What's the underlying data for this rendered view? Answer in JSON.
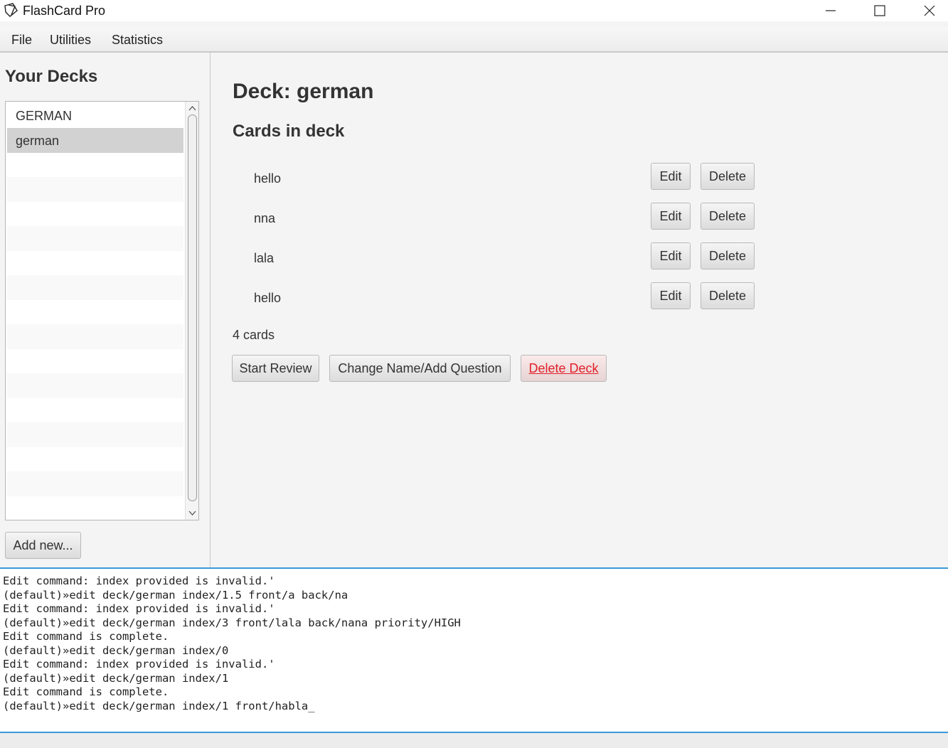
{
  "window": {
    "title": "FlashCard Pro"
  },
  "menu": {
    "items": [
      "File",
      "Utilities",
      "Statistics"
    ]
  },
  "sidebar": {
    "title": "Your Decks",
    "decks": [
      "GERMAN",
      "german"
    ],
    "selected_index": 1,
    "add_button": "Add new..."
  },
  "main": {
    "deck_title": "Deck: german",
    "cards_heading": "Cards in deck",
    "cards": [
      {
        "front": "hello",
        "edit": "Edit",
        "delete": "Delete"
      },
      {
        "front": "nna",
        "edit": "Edit",
        "delete": "Delete"
      },
      {
        "front": "lala",
        "edit": "Edit",
        "delete": "Delete"
      },
      {
        "front": "hello",
        "edit": "Edit",
        "delete": "Delete"
      }
    ],
    "card_count": "4 cards",
    "actions": {
      "start_review": "Start Review",
      "change_name": "Change Name/Add Question",
      "delete_deck": "Delete Deck"
    }
  },
  "console": {
    "lines": [
      "Edit command: index provided is invalid.'",
      "(default)»edit deck/german index/1.5 front/a back/na",
      "Edit command: index provided is invalid.'",
      "(default)»edit deck/german index/3 front/lala back/nana priority/HIGH",
      "Edit command is complete.",
      "(default)»edit deck/german index/0",
      "Edit command: index provided is invalid.'",
      "(default)»edit deck/german index/1",
      "Edit command is complete.",
      "(default)»edit deck/german index/1 front/habla_"
    ]
  },
  "colors": {
    "accent": "#3a9ad9",
    "danger": "#e0202a",
    "selected_row": "#d2d2d2"
  }
}
